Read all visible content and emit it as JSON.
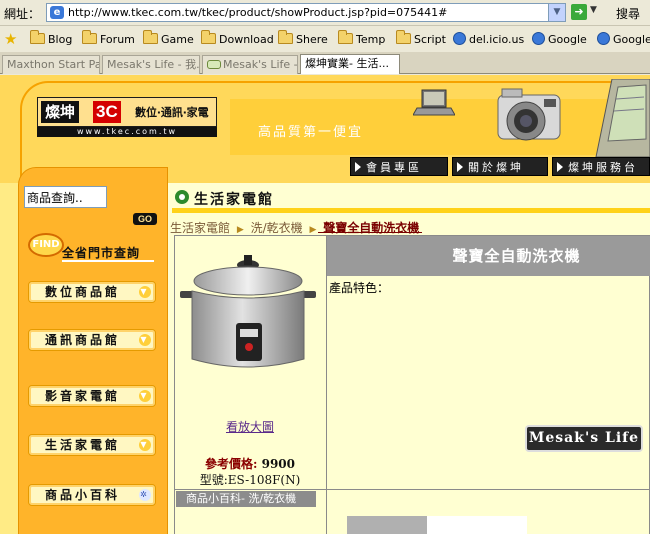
{
  "browser": {
    "address_label": "網址：",
    "url": "http://www.tkec.com.tw/tkec/product/showProduct.jsp?pid=075441#",
    "search_label": "搜尋",
    "favorites": [
      "Blog",
      "Forum",
      "Game",
      "Download",
      "Shere",
      "Temp",
      "Script",
      "del.icio.us",
      "Google",
      "Google"
    ],
    "tabs": [
      "Maxthon Start Page",
      "Mesak's Life - 我...",
      "Mesak's Life - ...",
      "燦坤實業- 生活..."
    ]
  },
  "header": {
    "logo_main": "燦坤",
    "logo_3c": "3C",
    "logo_sub": "數位‧通訊‧家電",
    "logo_url": "www.tkec.com.tw",
    "slogan": "高品質第一便宜",
    "nav": [
      "會員專區",
      "關於燦坤",
      "燦坤服務台"
    ]
  },
  "sidebar": {
    "search_value": "商品查詢..",
    "go_label": "GO",
    "store_bubble": "FIND",
    "store_label": "全省門市查詢",
    "items": [
      "數位商品館",
      "通訊商品館",
      "影音家電館",
      "生活家電館",
      "商品小百科"
    ]
  },
  "content": {
    "category_title": "生活家電館",
    "breadcrumb": [
      "生活家電館",
      "洗/乾衣機",
      "聲寶全自動洗衣機"
    ],
    "product_title": "聲寶全自動洗衣機",
    "feature_label": "產品特色：",
    "enlarge_link": "看放大圖",
    "price_label": "參考價格:",
    "price_value": "9900",
    "model": "型號:ES-108F(N)",
    "wiki_bar": "商品小百科- 洗/乾衣機"
  },
  "watermark": "Mesak's Life"
}
